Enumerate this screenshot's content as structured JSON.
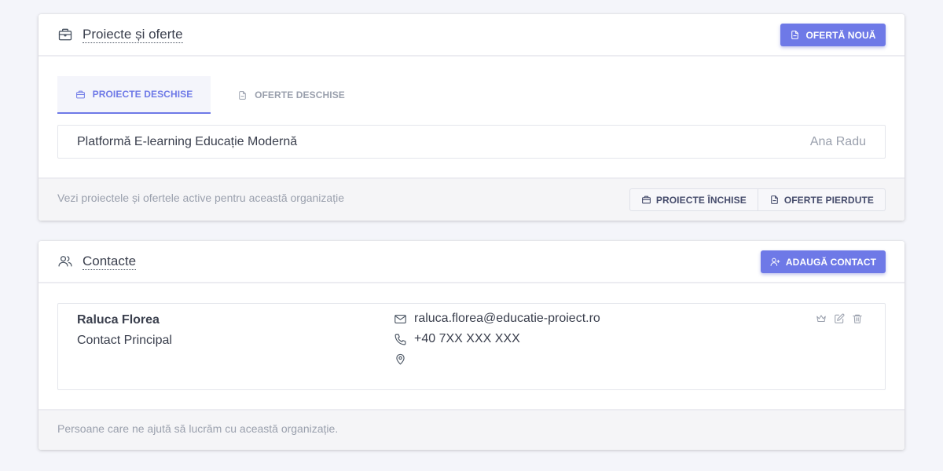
{
  "projects_card": {
    "title": "Proiecte și oferte",
    "new_offer_button": "OFERTĂ NOUĂ",
    "tabs": [
      {
        "label": "PROIECTE DESCHISE",
        "active": true,
        "icon": "briefcase-icon"
      },
      {
        "label": "OFERTE DESCHISE",
        "active": false,
        "icon": "document-icon"
      }
    ],
    "projects": [
      {
        "name": "Platformă E-learning Educație Modernă",
        "owner": "Ana Radu"
      }
    ],
    "footer_text": "Vezi proiectele și ofertele active pentru această organizație",
    "closed_projects_button": "PROIECTE ÎNCHISE",
    "lost_offers_button": "OFERTE PIERDUTE"
  },
  "contacts_card": {
    "title": "Contacte",
    "add_contact_button": "ADAUGĂ CONTACT",
    "contacts": [
      {
        "name": "Raluca Florea",
        "role": "Contact Principal",
        "email": "raluca.florea@educatie-proiect.ro",
        "phone": "+40 7XX XXX XXX",
        "location": ""
      }
    ],
    "footer_text": "Persoane care ne ajută să lucrăm cu această organizație."
  },
  "colors": {
    "accent": "#6e79e7",
    "background": "#f4f5fa",
    "muted_text": "#9aa0ad"
  }
}
